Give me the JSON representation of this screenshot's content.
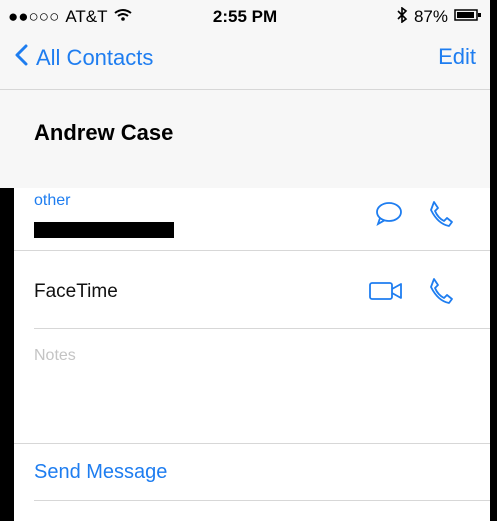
{
  "status_bar": {
    "signal": "●●○○○",
    "carrier": "AT&T",
    "time": "2:55 PM",
    "battery_percent": "87%"
  },
  "nav": {
    "back_label": "All Contacts",
    "edit_label": "Edit"
  },
  "contact": {
    "name": "Andrew Case"
  },
  "phone_row": {
    "label": "other"
  },
  "facetime_row": {
    "label": "FaceTime"
  },
  "notes_row": {
    "placeholder": "Notes"
  },
  "actions": {
    "send_message": "Send Message"
  },
  "colors": {
    "accent": "#1e7df0"
  },
  "icons": {
    "back": "chevron-left-icon",
    "message": "message-bubble-icon",
    "phone": "phone-icon",
    "video": "video-camera-icon",
    "wifi": "wifi-icon",
    "bluetooth": "bluetooth-icon",
    "battery": "battery-icon"
  }
}
